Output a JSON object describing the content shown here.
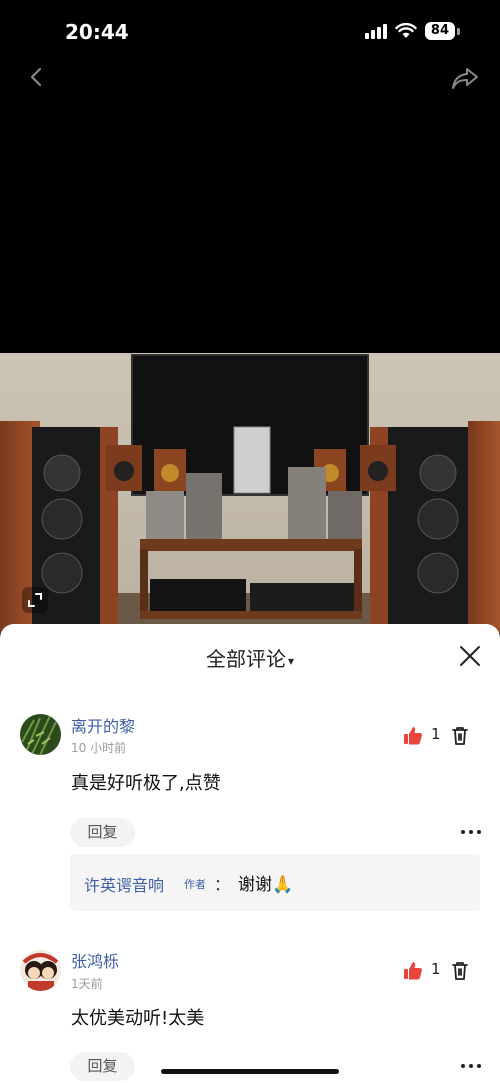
{
  "status_bar": {
    "time": "20:44",
    "battery": "84"
  },
  "photo": {
    "description_icon": "expand-icon"
  },
  "comments_panel": {
    "title": "全部评论",
    "sort_caret": "▾",
    "comments": [
      {
        "user": "离开的黎",
        "time": "10 小时前",
        "text": "真是好听极了,点赞",
        "likes": "1",
        "reply_label": "回复",
        "author_reply": {
          "name": "许英谔音响",
          "badge": "作者",
          "separator": "：",
          "text": "谢谢🙏"
        }
      },
      {
        "user": "张鸿栎",
        "time": "1天前",
        "text": "太优美动听!太美",
        "likes": "1",
        "reply_label": "回复"
      }
    ]
  },
  "colors": {
    "accent_blue": "#3f5fa6",
    "like_red": "#e8453c"
  }
}
